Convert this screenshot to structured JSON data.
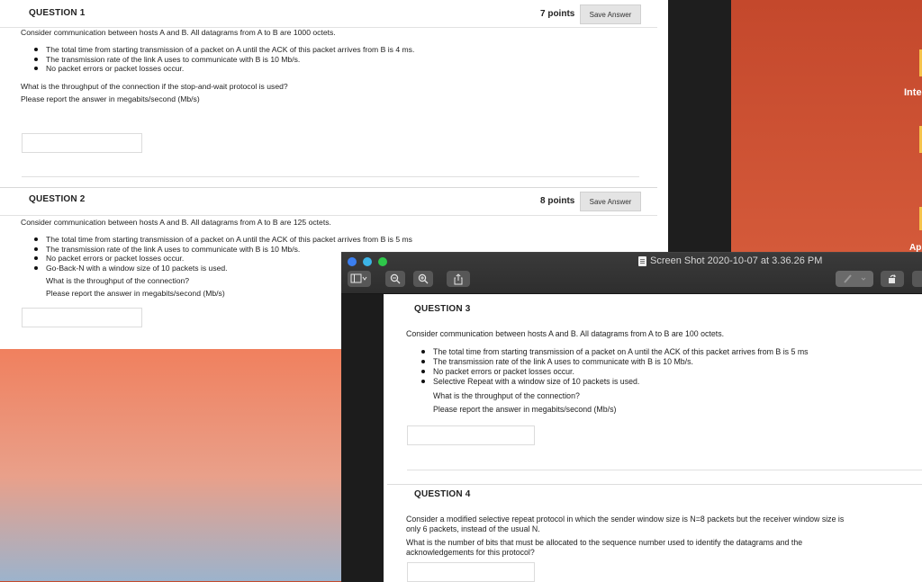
{
  "desktop": {
    "label_inte": "Inte",
    "label_ap": "Ap"
  },
  "back_page": {
    "questions": [
      {
        "title": "QUESTION 1",
        "points": "7 points",
        "save": "Save Answer",
        "intro": "Consider communication between hosts A and B. All datagrams from A to B are 1000 octets.",
        "bullets": [
          "The total time from starting transmission of a packet on A until the ACK of this packet arrives from B is 4 ms.",
          "The transmission rate of the link A uses to communicate with B is 10 Mb/s.",
          "No packet errors or packet losses occur."
        ],
        "ask1": "What is the throughput of the connection if the stop-and-wait protocol is used?",
        "ask2": "Please report the answer in megabits/second (Mb/s)",
        "answer_value": ""
      },
      {
        "title": "QUESTION 2",
        "points": "8 points",
        "save": "Save Answer",
        "intro": "Consider communication between hosts A and B. All datagrams from A to B are 125 octets.",
        "bullets": [
          "The total time from starting transmission of a packet on A until the ACK of this packet arrives from B is 5 ms",
          "The transmission rate of the link A uses to communicate with B is 10 Mb/s.",
          "No packet errors or packet losses occur.",
          "Go-Back-N with a window size of 10 packets is used."
        ],
        "ask1": "What is the throughput of the connection?",
        "ask2": "Please report the answer in megabits/second (Mb/s)",
        "answer_value": ""
      }
    ]
  },
  "preview": {
    "window_title": "Screen Shot 2020-10-07 at 3.36.26 PM",
    "toolbar": {
      "sidebar_icon": "sidebar-toggle-icon",
      "zoom_out_icon": "zoom-out-icon",
      "zoom_in_icon": "zoom-in-icon",
      "share_icon": "share-icon",
      "markup_icon": "pen-icon",
      "rotate_icon": "rotate-icon"
    },
    "q3": {
      "title": "QUESTION 3",
      "intro": "Consider communication between hosts A and B. All datagrams from A to B are 100 octets.",
      "bullets": [
        "The total time from starting transmission of a packet on A until the ACK of this packet arrives from B is 5 ms",
        "The transmission rate of the link A uses to communicate with B is 10 Mb/s.",
        "No packet errors or packet losses occur.",
        "Selective Repeat with a window size of 10 packets is used."
      ],
      "ask1": "What is the throughput of the connection?",
      "ask2": "Please report the answer in megabits/second (Mb/s)"
    },
    "q4": {
      "title": "QUESTION 4",
      "line1": "Consider a modified selective repeat protocol in which the sender window size is N=8 packets but the receiver window size is",
      "line2": "only 6 packets, instead of the usual N.",
      "line3": "What is the number of bits that must be allocated to the sequence number used to identify the datagrams and the",
      "line4": "acknowledgements for this protocol?"
    }
  }
}
